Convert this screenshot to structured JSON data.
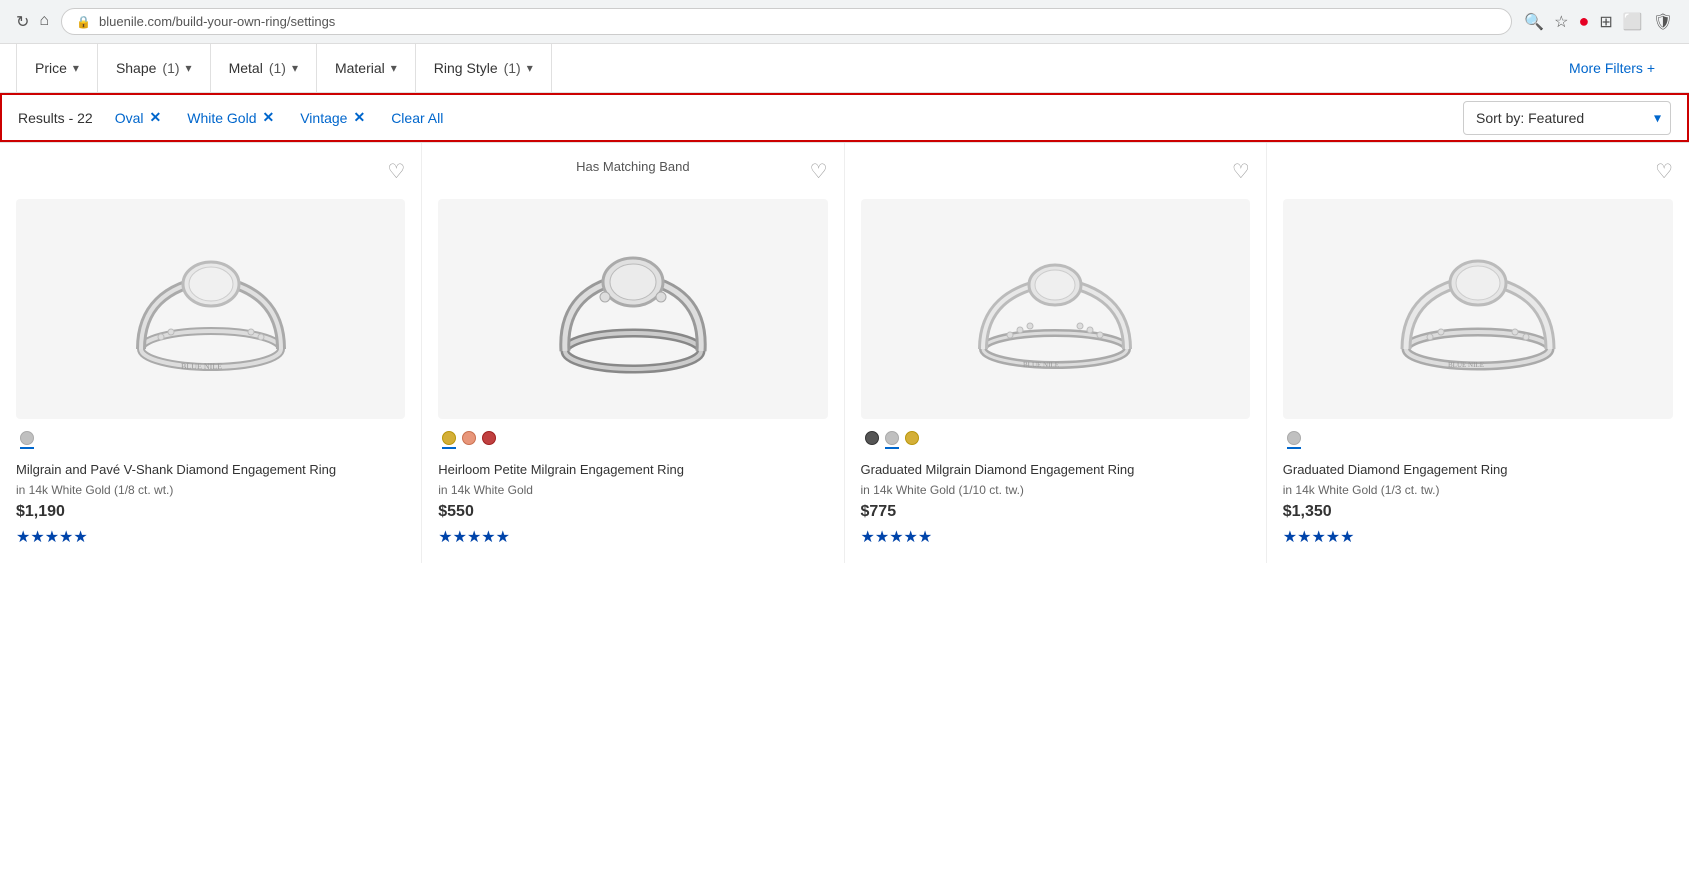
{
  "browser": {
    "url": "bluenile.com/build-your-own-ring/settings"
  },
  "filters": {
    "price_label": "Price",
    "shape_label": "Shape",
    "shape_count": "(1)",
    "metal_label": "Metal",
    "metal_count": "(1)",
    "material_label": "Material",
    "ring_style_label": "Ring Style",
    "ring_style_count": "(1)",
    "more_filters_label": "More Filters +"
  },
  "active_filters": {
    "results_label": "Results - 22",
    "chip1_label": "Oval",
    "chip2_label": "White Gold",
    "chip3_label": "Vintage",
    "clear_all_label": "Clear All"
  },
  "sort": {
    "label": "Sort by: Featured"
  },
  "matching_band": {
    "label": "Has Matching Band"
  },
  "products": [
    {
      "name": "Milgrain and Pavé V-Shank Diamond Engagement Ring",
      "metal": "in 14k White Gold (1/8 ct. wt.)",
      "price": "$1,190",
      "stars": "★★★★★",
      "dots": [
        {
          "color": "#c0c0c0",
          "selected": true
        }
      ],
      "show_heart": true,
      "show_matching_band": false
    },
    {
      "name": "Heirloom Petite Milgrain Engagement Ring",
      "metal": "in 14k White Gold",
      "price": "$550",
      "stars": "★★★★★",
      "dots": [
        {
          "color": "#d4af37",
          "selected": false
        },
        {
          "color": "#e8967a",
          "selected": false
        },
        {
          "color": "#c04040",
          "selected": false
        }
      ],
      "show_heart": true,
      "show_matching_band": true
    },
    {
      "name": "Graduated Milgrain Diamond Engagement Ring",
      "metal": "in 14k White Gold (1/10 ct. tw.)",
      "price": "$775",
      "stars": "★★★★★",
      "dots": [
        {
          "color": "#555",
          "selected": false
        },
        {
          "color": "#c0c0c0",
          "selected": true
        },
        {
          "color": "#d4af37",
          "selected": false
        }
      ],
      "show_heart": true,
      "show_matching_band": false
    },
    {
      "name": "Graduated Diamond Engagement Ring",
      "metal": "in 14k White Gold (1/3 ct. tw.)",
      "price": "$1,350",
      "stars": "★★★★★",
      "dots": [
        {
          "color": "#c0c0c0",
          "selected": true
        }
      ],
      "show_heart": true,
      "show_matching_band": false
    }
  ]
}
